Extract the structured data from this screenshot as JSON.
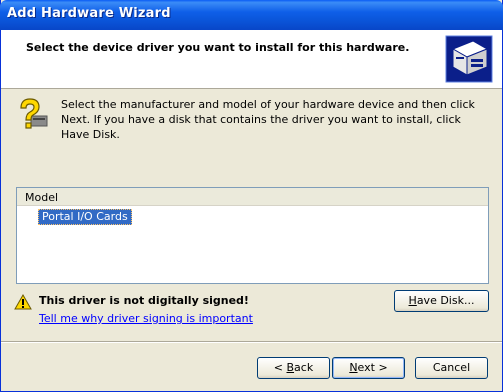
{
  "window": {
    "title": "Add Hardware Wizard"
  },
  "header": {
    "title": "Select the device driver you want to install for this hardware.",
    "icon": "hardware-icon"
  },
  "intro": {
    "icon": "question-icon",
    "text": "Select the manufacturer and model of your hardware device and then click Next. If you have a disk that contains the driver you want to install, click Have Disk."
  },
  "model_list": {
    "header": "Model",
    "items": [
      {
        "label": "Portal I/O Cards",
        "selected": true
      }
    ]
  },
  "warning": {
    "icon": "warning-icon",
    "text": "This driver is not digitally signed!",
    "link": "Tell me why driver signing is important"
  },
  "buttons": {
    "have_disk": {
      "accel": "H",
      "rest": "ave Disk..."
    },
    "back": {
      "prefix": "< ",
      "accel": "B",
      "rest": "ack"
    },
    "next": {
      "accel": "N",
      "rest": "ext >"
    },
    "cancel": "Cancel"
  },
  "colors": {
    "titlebar": "#0a54d8",
    "selection": "#316ac5",
    "dialog_bg": "#ece9d8",
    "link": "#0000ff"
  }
}
